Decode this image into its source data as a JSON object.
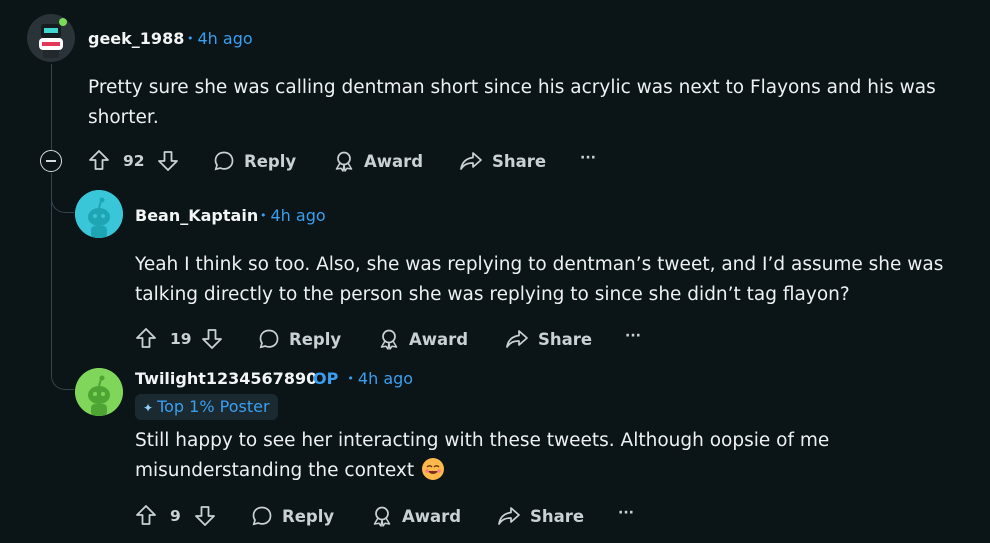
{
  "comments": [
    {
      "username": "geek_1988",
      "time": "4h ago",
      "lines": [
        "Pretty sure she was calling dentman short since his acrylic was next to Flayons and his was",
        "shorter."
      ],
      "votes": "92",
      "reply": "Reply",
      "award": "Award",
      "share": "Share",
      "more": "···"
    },
    {
      "username": "Bean_Kaptain",
      "time": "4h ago",
      "lines": [
        "Yeah I think so too. Also, she was replying to dentman’s tweet, and I’d assume she was",
        "talking directly to the person she was replying to since she didn’t tag flayon?"
      ],
      "votes": "19",
      "reply": "Reply",
      "award": "Award",
      "share": "Share",
      "more": "···"
    },
    {
      "username": "Twilight1234567890",
      "op": "OP",
      "time": "4h ago",
      "flair": "Top 1% Poster",
      "lines": [
        "Still happy to see her interacting with these tweets. Although oopsie of me",
        "misunderstanding the context"
      ],
      "votes": "9",
      "reply": "Reply",
      "award": "Award",
      "share": "Share",
      "more": "···"
    }
  ],
  "colors": {
    "background": "#0b1416",
    "accent": "#3a9ff0",
    "text": "#f2f4f5",
    "thread_line": "#33464c"
  },
  "icons": [
    "upvote-icon",
    "downvote-icon",
    "reply-icon",
    "award-icon",
    "share-icon",
    "more-icon",
    "collapse-icon",
    "emoji-icon"
  ]
}
